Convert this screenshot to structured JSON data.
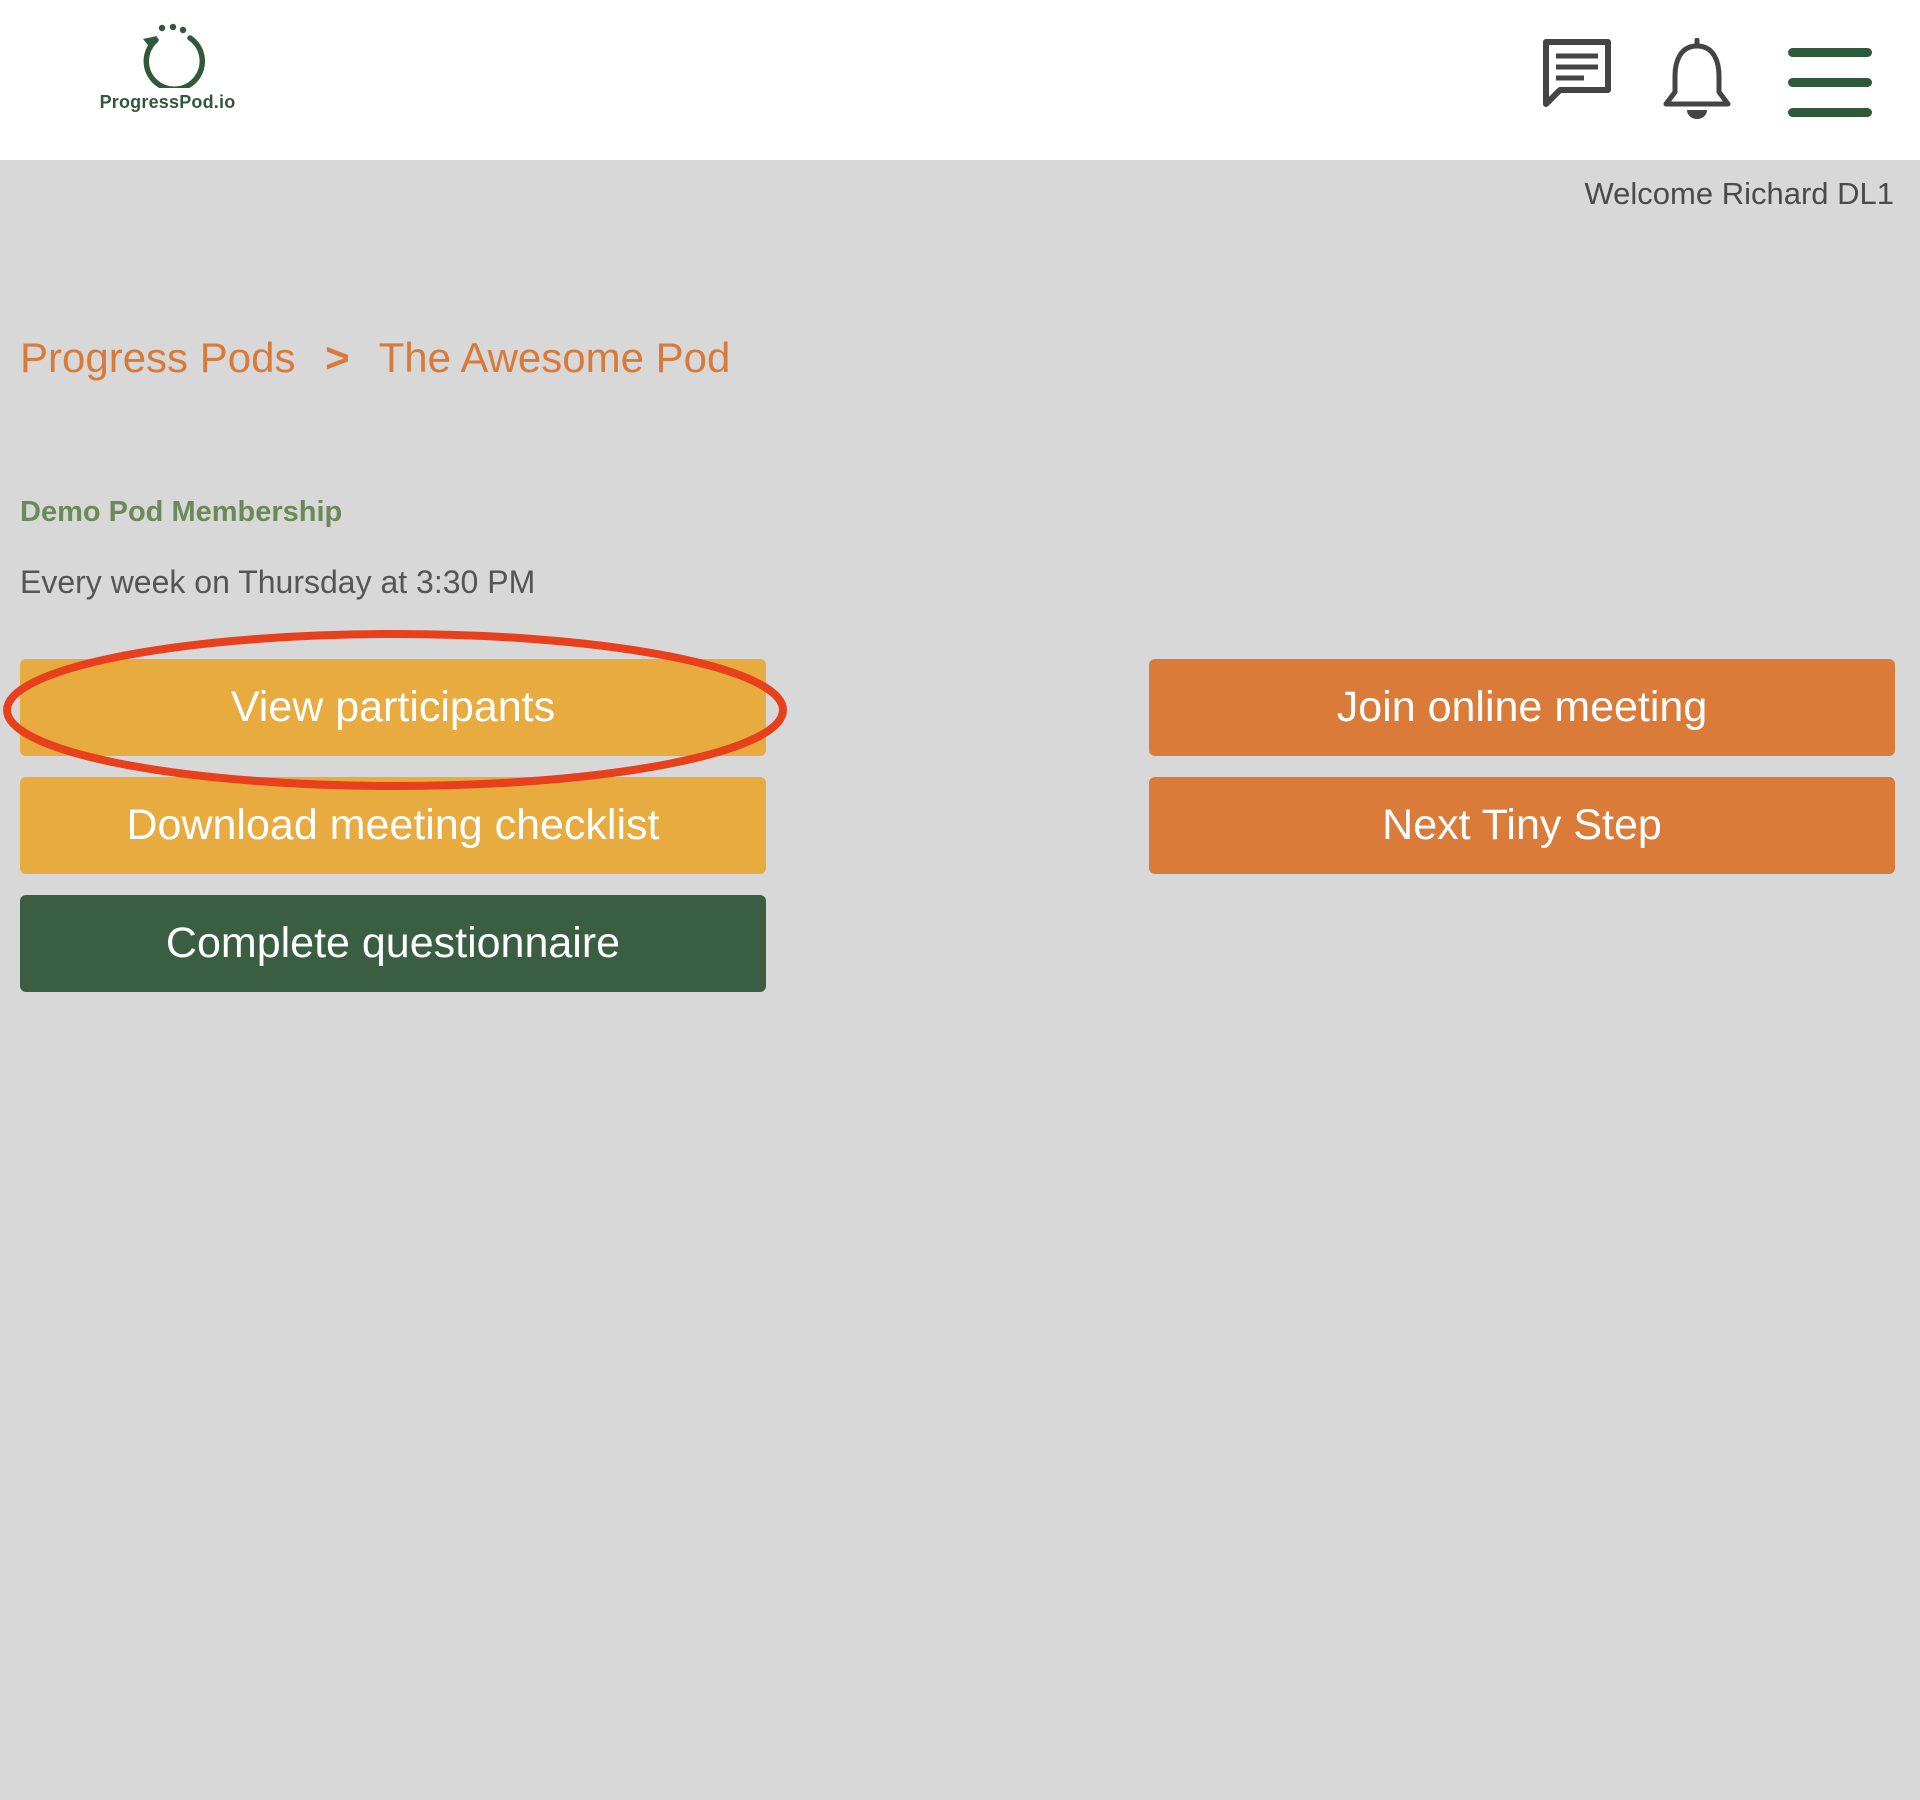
{
  "header": {
    "logo_text": "ProgressPod.io",
    "icons": [
      "chat-icon",
      "bell-icon",
      "hamburger-menu-icon"
    ],
    "brand_color": "#2f5a3a"
  },
  "welcome_text": "Welcome Richard DL1",
  "breadcrumb": {
    "root": "Progress Pods",
    "separator": ">",
    "current": "The Awesome Pod"
  },
  "pod": {
    "title": "Demo Pod Membership",
    "schedule": "Every week on Thursday at 3:30 PM"
  },
  "buttons": {
    "view_participants": "View participants",
    "download_checklist": "Download meeting checklist",
    "complete_questionnaire": "Complete questionnaire",
    "join_meeting": "Join online meeting",
    "next_tiny_step": "Next Tiny Step"
  },
  "colors": {
    "accent_orange": "#db7b3a",
    "accent_yellow": "#e8ab40",
    "accent_green": "#3a5e42",
    "annotation_red": "#e8401c"
  }
}
